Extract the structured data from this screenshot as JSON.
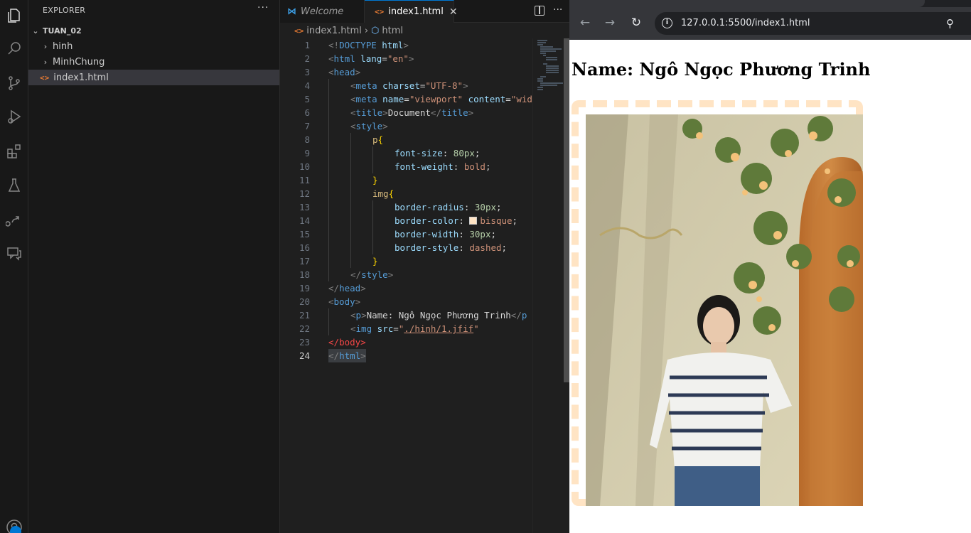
{
  "sidebar": {
    "title": "EXPLORER",
    "more": "···",
    "folder": "TUAN_02",
    "items": [
      {
        "label": "hinh",
        "type": "folder"
      },
      {
        "label": "MinhChung",
        "type": "folder"
      },
      {
        "label": "index1.html",
        "type": "file"
      }
    ]
  },
  "editor": {
    "tabs": [
      {
        "label": "Welcome"
      },
      {
        "label": "index1.html"
      }
    ],
    "tab_close": "✕",
    "breadcrumb": {
      "file": "index1.html",
      "sep": "›",
      "symbol": "html"
    },
    "line_numbers": [
      "1",
      "2",
      "3",
      "4",
      "5",
      "6",
      "7",
      "8",
      "9",
      "10",
      "11",
      "12",
      "13",
      "14",
      "15",
      "16",
      "17",
      "18",
      "19",
      "20",
      "21",
      "22",
      "23",
      "24"
    ]
  },
  "code": {
    "l1": [
      "<!",
      "DOCTYPE",
      " ",
      "html",
      ">"
    ],
    "l2": [
      "<",
      "html",
      " ",
      "lang",
      "=",
      "\"en\"",
      ">"
    ],
    "l3": [
      "<",
      "head",
      ">"
    ],
    "l4": [
      "<",
      "meta",
      " ",
      "charset",
      "=",
      "\"UTF-8\"",
      ">"
    ],
    "l5": [
      "<",
      "meta",
      " ",
      "name",
      "=",
      "\"viewport\"",
      " ",
      "content",
      "=",
      "\"wid"
    ],
    "l6": [
      "<",
      "title",
      ">",
      "Document",
      "</",
      "title",
      ">"
    ],
    "l7": [
      "<",
      "style",
      ">"
    ],
    "l8": [
      "p",
      "{"
    ],
    "l9": [
      "font-size",
      ": ",
      "80px",
      ";"
    ],
    "l10": [
      "font-weight",
      ": ",
      "bold",
      ";"
    ],
    "l11": [
      "}"
    ],
    "l12": [
      "img",
      "{"
    ],
    "l13": [
      "border-radius",
      ": ",
      "30px",
      ";"
    ],
    "l14": [
      "border-color",
      ": ",
      "bisque",
      ";"
    ],
    "l15": [
      "border-width",
      ": ",
      "30px",
      ";"
    ],
    "l16": [
      "border-style",
      ": ",
      "dashed",
      ";"
    ],
    "l17": [
      "}"
    ],
    "l18": [
      "</",
      "style",
      ">"
    ],
    "l19": [
      "</",
      "head",
      ">"
    ],
    "l20": [
      "<",
      "body",
      ">"
    ],
    "l21": [
      "<",
      "p",
      ">",
      "Name: Ngô Ngọc Phương Trinh",
      "</",
      "p"
    ],
    "l22": [
      "<",
      "img",
      " ",
      "src",
      "=",
      "\"",
      "./hinh/1.jfif",
      "\""
    ],
    "l23": [
      "</",
      "body",
      ">"
    ],
    "l24": [
      "</",
      "html",
      ">"
    ]
  },
  "browser": {
    "url": "127.0.0.1:5500/index1.html",
    "back": "←",
    "forward": "→",
    "reload": "↻",
    "info": "i",
    "heading": "Name: Ngô Ngọc Phương Trinh",
    "image_border_color": "#ffe4c4"
  },
  "colors": {
    "accent": "#0078d4",
    "tag": "#569cd6",
    "attr": "#9cdcfe",
    "string": "#ce9178",
    "selector": "#d7ba7d",
    "number": "#b5cea8"
  }
}
